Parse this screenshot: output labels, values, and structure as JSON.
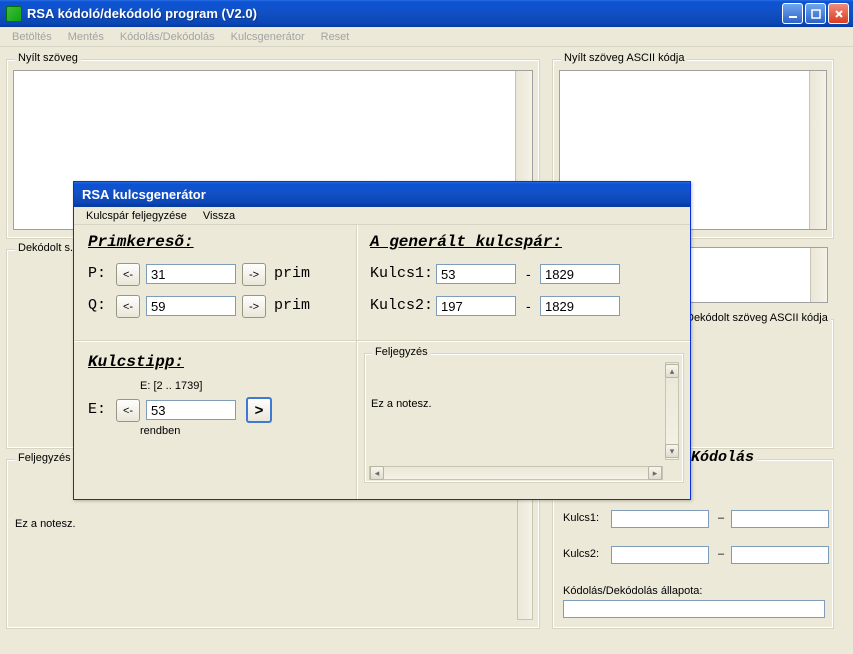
{
  "window": {
    "title": "RSA kódoló/dekódoló program (V2.0)",
    "menu": [
      "Betöltés",
      "Mentés",
      "Kódolás/Dekódolás",
      "Kulcsgenerátor",
      "Reset"
    ]
  },
  "groups": {
    "plain": "Nyílt szöveg",
    "plain_ascii": "Nyílt szöveg ASCII kódja",
    "decoded_s": "Dekódolt s.",
    "decoded_ascii": "Dekódolt szöveg ASCII kódja",
    "notes": "Feljegyzés",
    "notes_text": "Ez a notesz.",
    "coding_header": "Kódolás",
    "kulcs1": "Kulcs1:",
    "kulcs2": "Kulcs2:",
    "status_label": "Kódolás/Dekódolás állapota:"
  },
  "dialog": {
    "title": "RSA kulcsgenerátor",
    "menu": [
      "Kulcspár feljegyzése",
      "Vissza"
    ],
    "prime_header": "Primkeresõ:",
    "P_label": "P:",
    "Q_label": "Q:",
    "P_value": "31",
    "Q_value": "59",
    "arrow_left": "<-",
    "arrow_right": "->",
    "prim": "prim",
    "keytip_header": "Kulcstipp:",
    "E_range": "E: [2 .. 1739]",
    "E_label": "E:",
    "E_value": "53",
    "E_status": "rendben",
    "gen_header": "A generált kulcspár:",
    "k1_label": "Kulcs1:",
    "k2_label": "Kulcs2:",
    "k1_a": "53",
    "k1_b": "1829",
    "k2_a": "197",
    "k2_b": "1829",
    "dash": "-",
    "note_legend": "Feljegyzés",
    "note_text": "Ez a notesz.",
    "go": ">"
  }
}
